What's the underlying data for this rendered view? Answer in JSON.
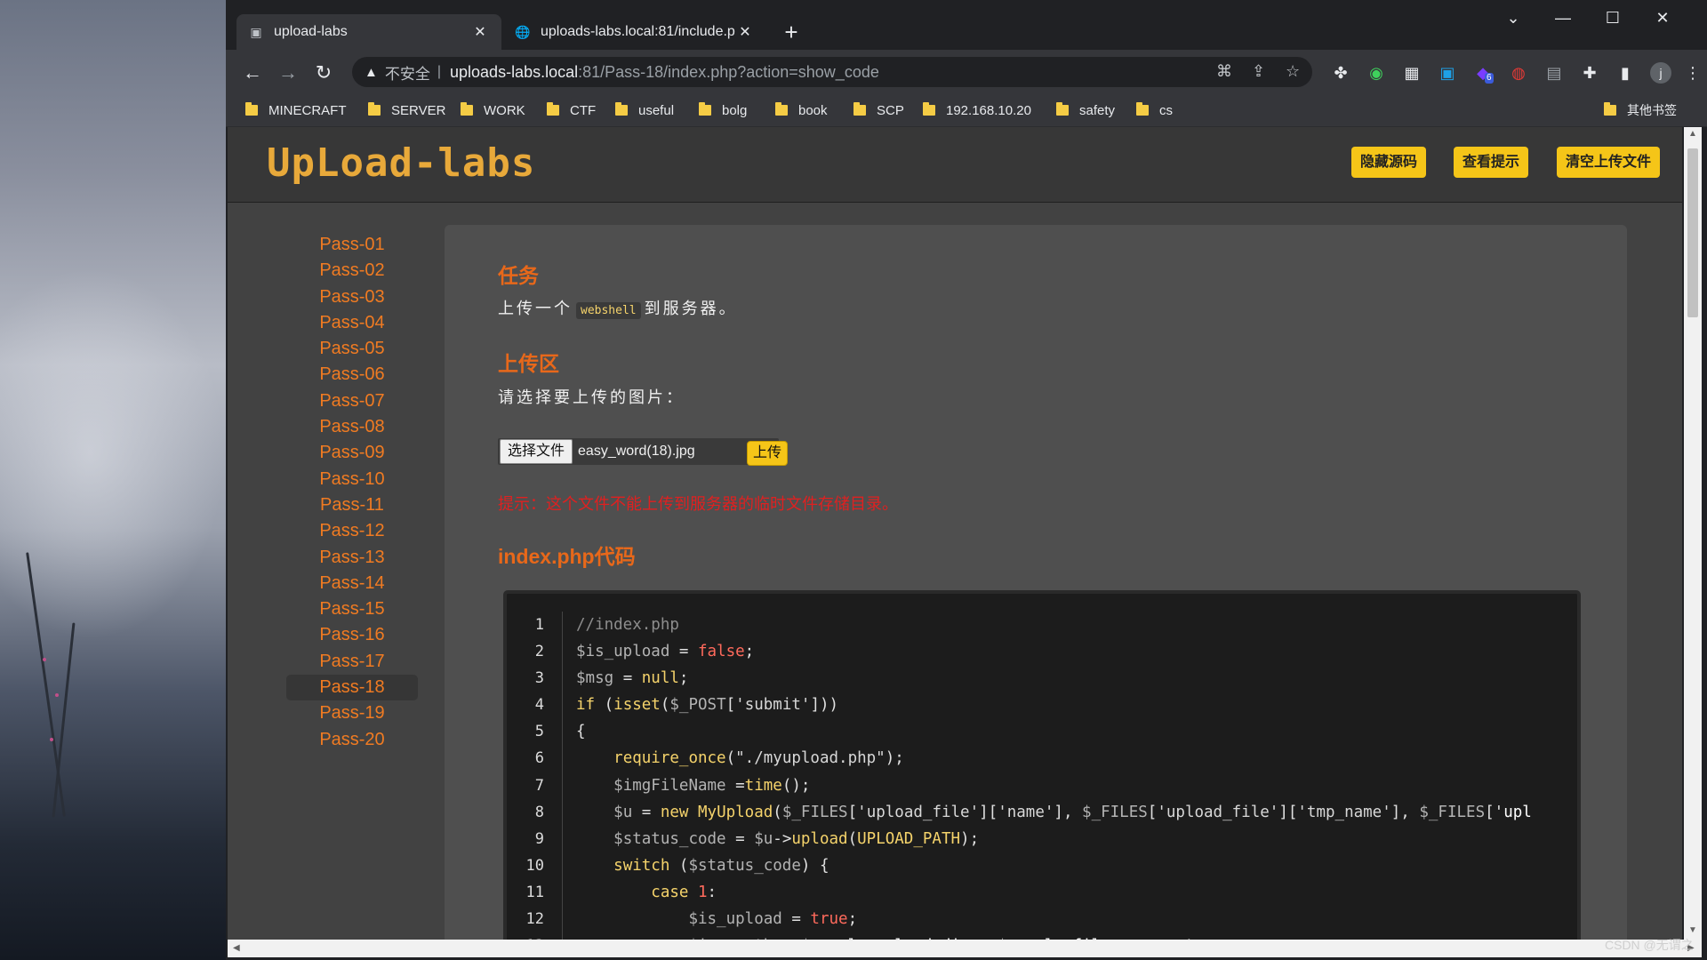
{
  "browser": {
    "tabs": [
      {
        "title": "upload-labs",
        "active": true
      },
      {
        "title": "uploads-labs.local:81/include.p",
        "active": false
      }
    ],
    "address": {
      "insecure_label": "不安全",
      "host": "uploads-labs.local",
      "path": ":81/Pass-18/index.php?action=show_code"
    },
    "extension_badge": "6",
    "profile_initial": "j",
    "bookmarks": [
      "MINECRAFT",
      "SERVER",
      "WORK",
      "CTF",
      "useful",
      "bolg",
      "book",
      "SCP",
      "192.168.10.20",
      "safety",
      "cs"
    ],
    "other_bookmarks": "其他书签"
  },
  "page": {
    "logo_text": "UpLoad-labs",
    "header_buttons": [
      "隐藏源码",
      "查看提示",
      "清空上传文件"
    ],
    "sidebar": [
      "Pass-01",
      "Pass-02",
      "Pass-03",
      "Pass-04",
      "Pass-05",
      "Pass-06",
      "Pass-07",
      "Pass-08",
      "Pass-09",
      "Pass-10",
      "Pass-11",
      "Pass-12",
      "Pass-13",
      "Pass-14",
      "Pass-15",
      "Pass-16",
      "Pass-17",
      "Pass-18",
      "Pass-19",
      "Pass-20"
    ],
    "active_pass": "Pass-18",
    "task": {
      "heading": "任务",
      "text_before": "上传一个",
      "code_word": "webshell",
      "text_after": "到服务器。"
    },
    "upload": {
      "heading": "上传区",
      "prompt": "请选择要上传的图片：",
      "choose_button": "选择文件",
      "file_name": "easy_word(18).jpg",
      "submit_button": "上传",
      "tip": "提示：这个文件不能上传到服务器的临时文件存储目录。"
    },
    "code_heading": "index.php代码",
    "code_lines": [
      "//index.php",
      "$is_upload = false;",
      "$msg = null;",
      "if (isset($_POST['submit']))",
      "{",
      "    require_once(\"./myupload.php\");",
      "    $imgFileName =time();",
      "    $u = new MyUpload($_FILES['upload_file']['name'], $_FILES['upload_file']['tmp_name'], $_FILES['upl",
      "    $status_code = $u->upload(UPLOAD_PATH);",
      "    switch ($status_code) {",
      "        case 1:",
      "            $is_upload = true;",
      "            $img_path = $u->cls_upload_dir . $u->cls_file_rename_to;"
    ]
  },
  "watermark": "CSDN @无谓之"
}
